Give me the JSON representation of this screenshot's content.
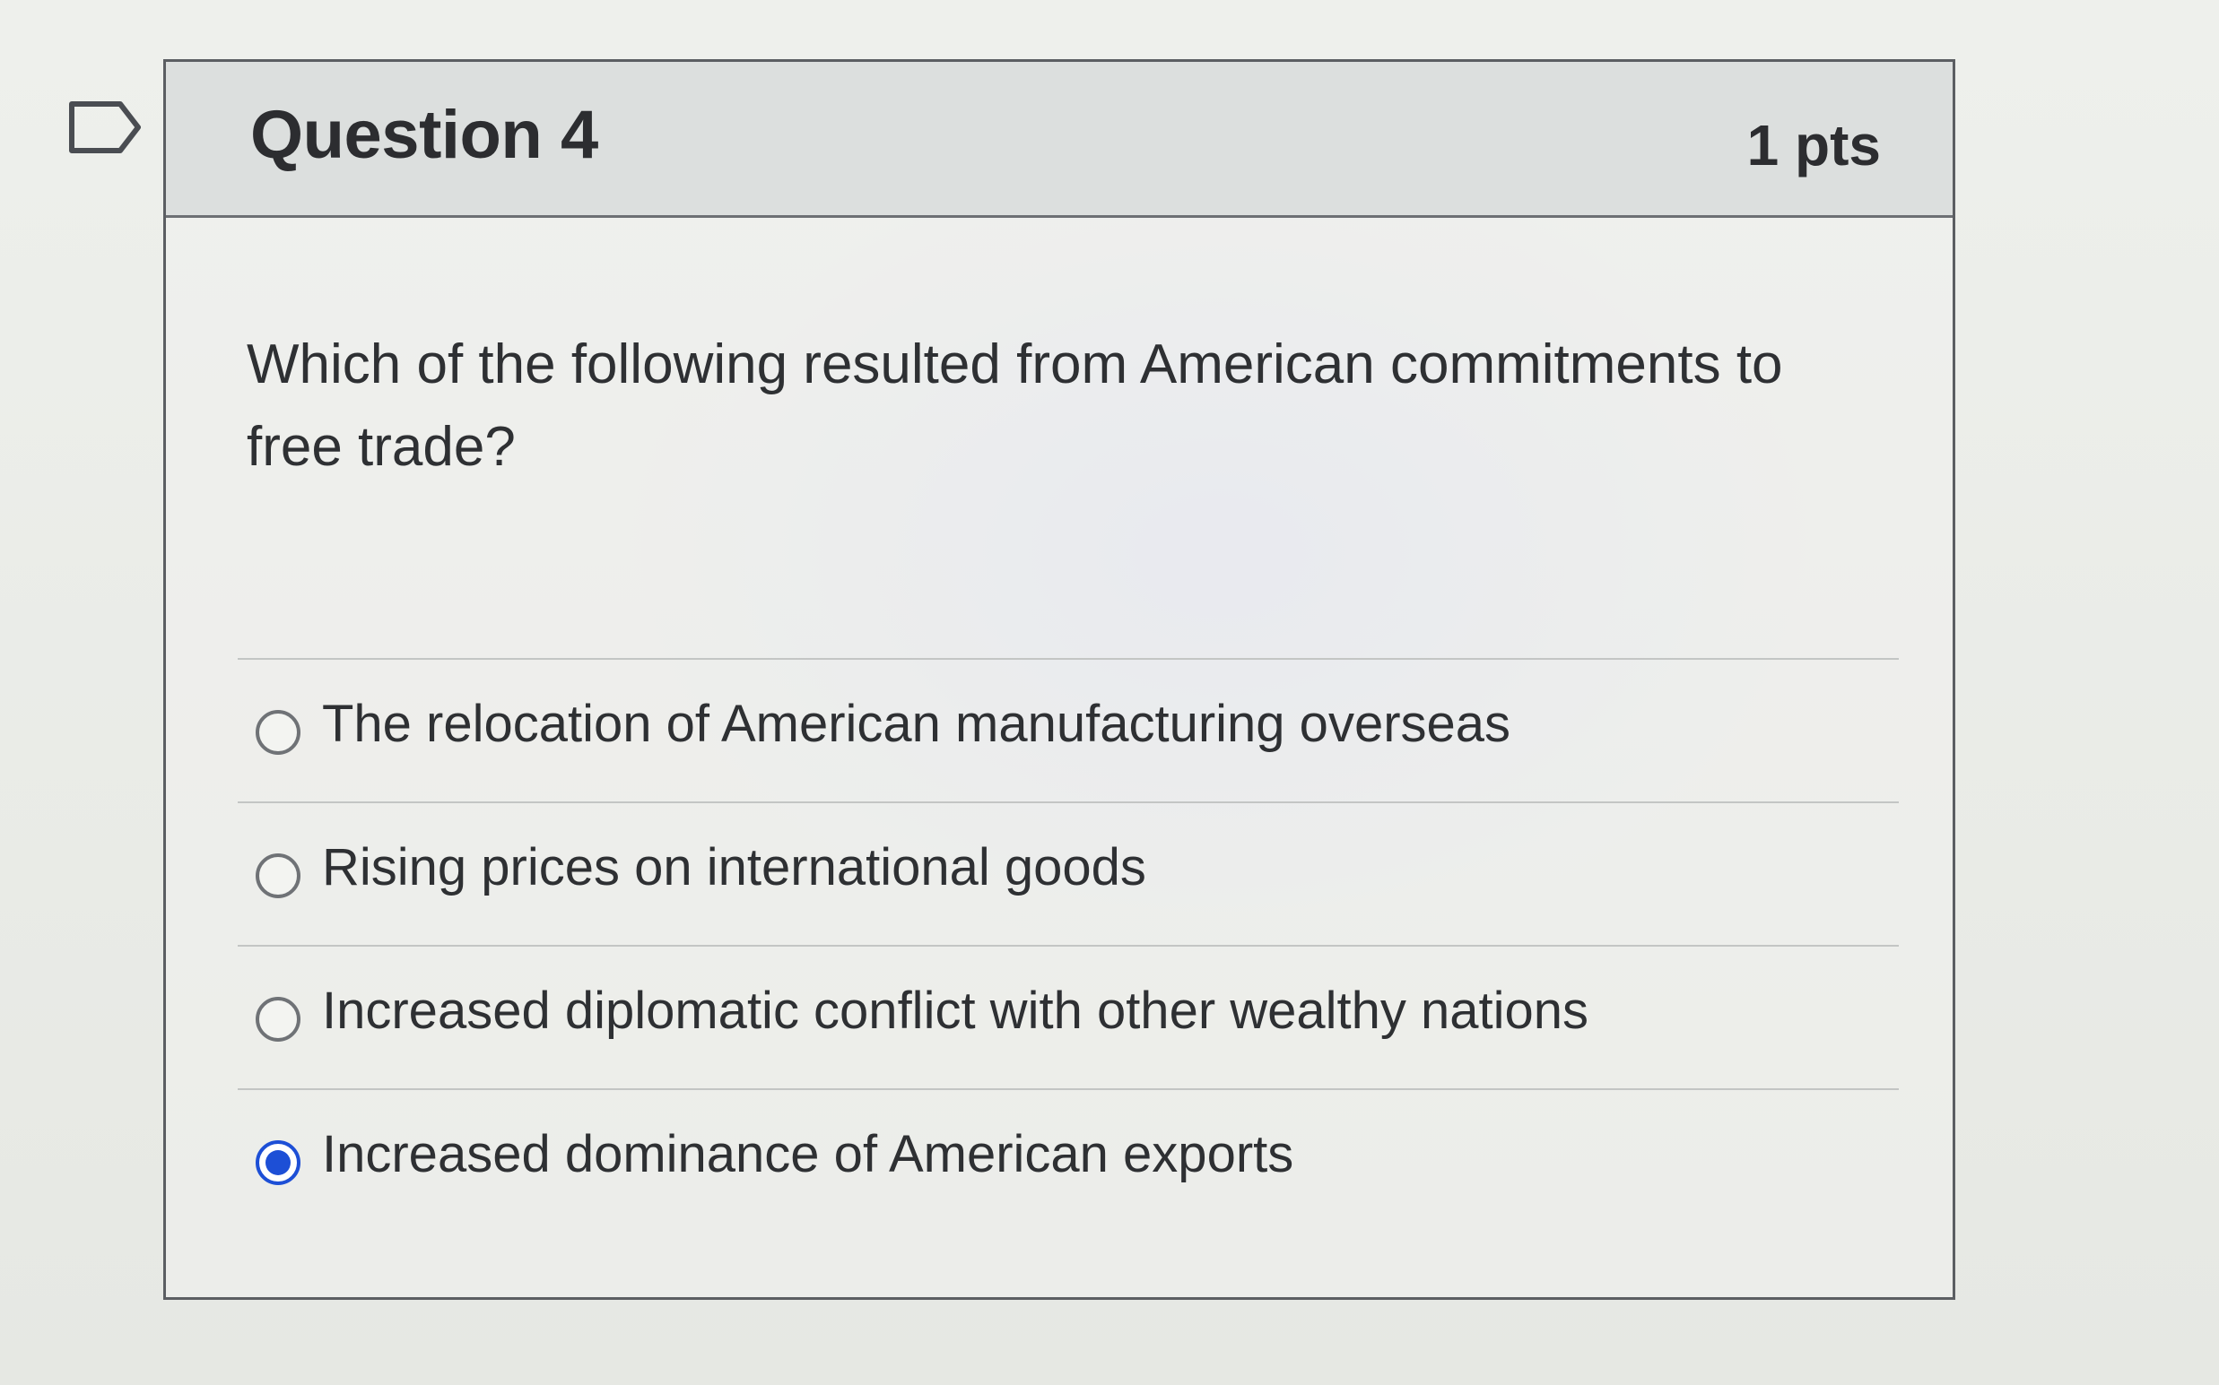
{
  "question": {
    "title": "Question 4",
    "points": "1 pts",
    "text": "Which of the following resulted from American commitments to free trade?",
    "flag_icon": "flag-bookmark-icon"
  },
  "answers": [
    {
      "label": "The relocation of American manufacturing overseas",
      "selected": false
    },
    {
      "label": "Rising prices on international goods",
      "selected": false
    },
    {
      "label": "Increased diplomatic conflict with other wealthy nations",
      "selected": false
    },
    {
      "label": "Increased dominance of American exports",
      "selected": true
    }
  ],
  "colors": {
    "selected_radio": "#1d4fd6",
    "border": "#5b5e62"
  }
}
